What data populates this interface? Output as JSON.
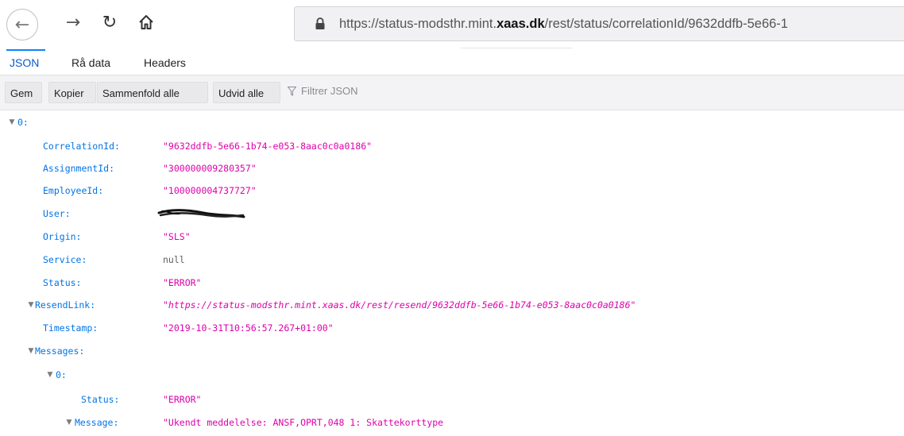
{
  "browser": {
    "url_prefix": "https://status-modsthr.mint.",
    "url_domain": "xaas.dk",
    "url_suffix": "/rest/status/correlationId/9632ddfb-5e66-1"
  },
  "tabs": [
    {
      "label": "JSON",
      "active": true
    },
    {
      "label": "Rå data",
      "active": false
    },
    {
      "label": "Headers",
      "active": false
    }
  ],
  "json_toolbar": {
    "save_label": "Gem",
    "copy_label": "Kopier",
    "collapse_label": "Sammenfold alle",
    "expand_label": "Udvid alle",
    "filter_placeholder": "Filtrer JSON"
  },
  "tree": {
    "root_key": "0:",
    "fields": [
      {
        "key": "CorrelationId:",
        "value": "\"9632ddfb-5e66-1b74-e053-8aac0c0a0186\""
      },
      {
        "key": "AssignmentId:",
        "value": "\"300000009280357\""
      },
      {
        "key": "EmployeeId:",
        "value": "\"100000004737727\""
      },
      {
        "key": "User:",
        "value": ""
      },
      {
        "key": "Origin:",
        "value": "\"SLS\""
      },
      {
        "key": "Service:",
        "value": "null"
      },
      {
        "key": "Status:",
        "value": "\"ERROR\""
      },
      {
        "key": "ResendLink:",
        "value": "\"https://status-modsthr.mint.xaas.dk/rest/resend/9632ddfb-5e66-1b74-e053-8aac0c0a0186\""
      },
      {
        "key": "Timestamp:",
        "value": "\"2019-10-31T10:56:57.267+01:00\""
      }
    ],
    "messages_key": "Messages:",
    "message_index_key": "0:",
    "message_status_key": "Status:",
    "message_status_value": "\"ERROR\"",
    "message_key": "Message:",
    "message_value": "\"Ukendt  meddelelse:  ANSF,OPRT,048  1:  Skattekorttype"
  },
  "colors": {
    "key": "#0074e8",
    "string": "#dd00a9",
    "null": "#5f5f66",
    "active_tab": "#0a84ff"
  }
}
